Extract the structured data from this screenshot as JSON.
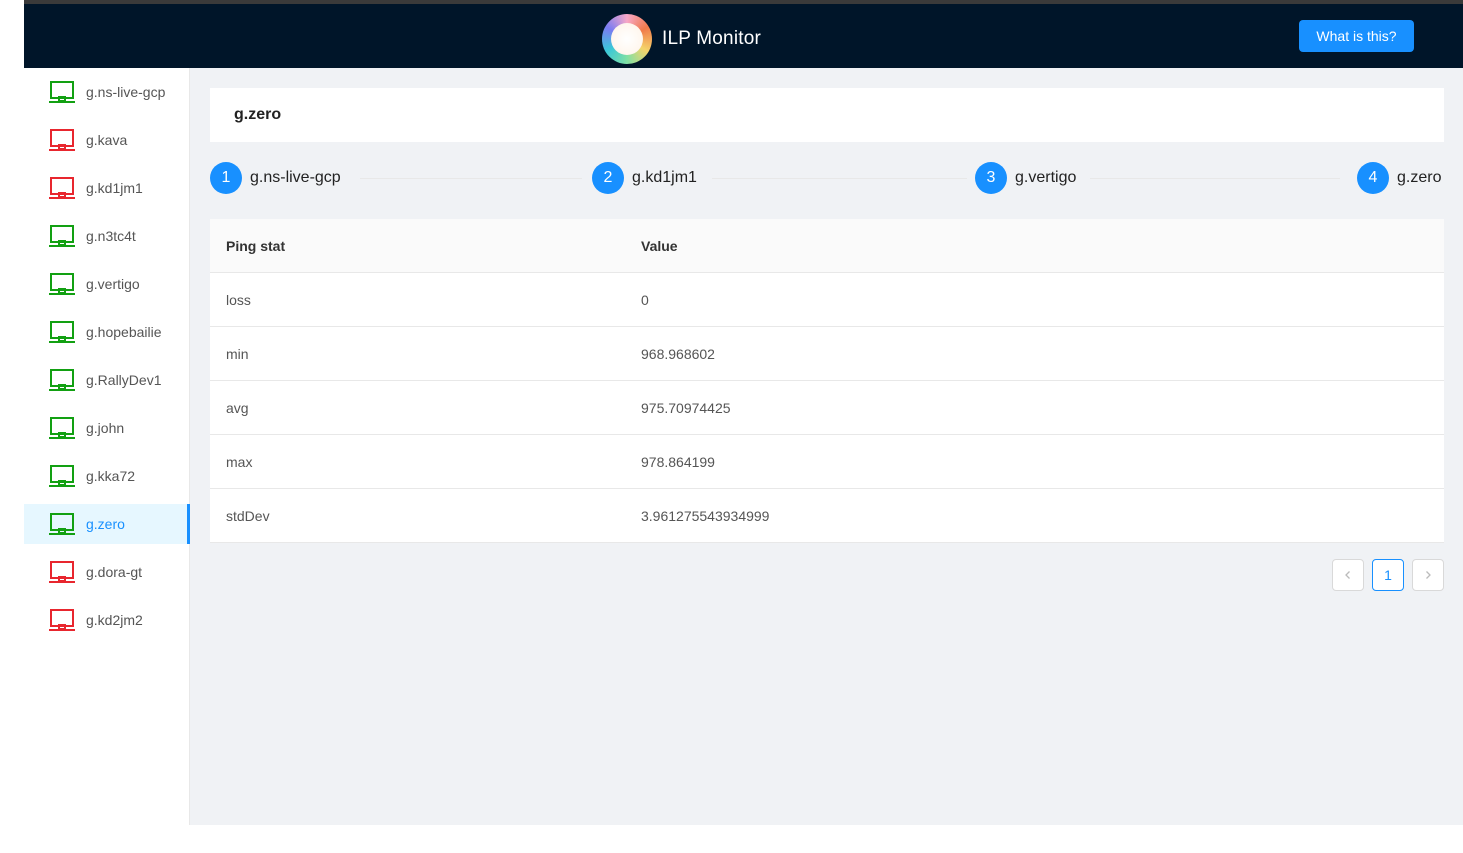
{
  "header": {
    "title": "ILP Monitor",
    "help_button": "What is this?"
  },
  "sidebar": {
    "items": [
      {
        "label": "g.ns-live-gcp",
        "status": "online"
      },
      {
        "label": "g.kava",
        "status": "offline"
      },
      {
        "label": "g.kd1jm1",
        "status": "offline"
      },
      {
        "label": "g.n3tc4t",
        "status": "online"
      },
      {
        "label": "g.vertigo",
        "status": "online"
      },
      {
        "label": "g.hopebailie",
        "status": "online"
      },
      {
        "label": "g.RallyDev1",
        "status": "online"
      },
      {
        "label": "g.john",
        "status": "online"
      },
      {
        "label": "g.kka72",
        "status": "online"
      },
      {
        "label": "g.zero",
        "status": "online",
        "selected": true
      },
      {
        "label": "g.dora-gt",
        "status": "offline"
      },
      {
        "label": "g.kd2jm2",
        "status": "offline"
      }
    ],
    "status_colors": {
      "online": "#12a012",
      "offline": "#e8262e"
    },
    "icon": "laptop-icon"
  },
  "main": {
    "title": "g.zero",
    "steps": [
      {
        "num": "1",
        "label": "g.ns-live-gcp"
      },
      {
        "num": "2",
        "label": "g.kd1jm1"
      },
      {
        "num": "3",
        "label": "g.vertigo"
      },
      {
        "num": "4",
        "label": "g.zero"
      }
    ],
    "table": {
      "headers": [
        "Ping stat",
        "Value"
      ],
      "rows": [
        [
          "loss",
          "0"
        ],
        [
          "min",
          "968.968602"
        ],
        [
          "avg",
          "975.70974425"
        ],
        [
          "max",
          "978.864199"
        ],
        [
          "stdDev",
          "3.961275543934999"
        ]
      ]
    },
    "pagination": {
      "current_page": "1",
      "prev_icon": "chevron-left-icon",
      "next_icon": "chevron-right-icon"
    }
  },
  "colors": {
    "accent": "#1890ff",
    "header_bg": "#001529",
    "content_bg": "#f0f2f5"
  }
}
